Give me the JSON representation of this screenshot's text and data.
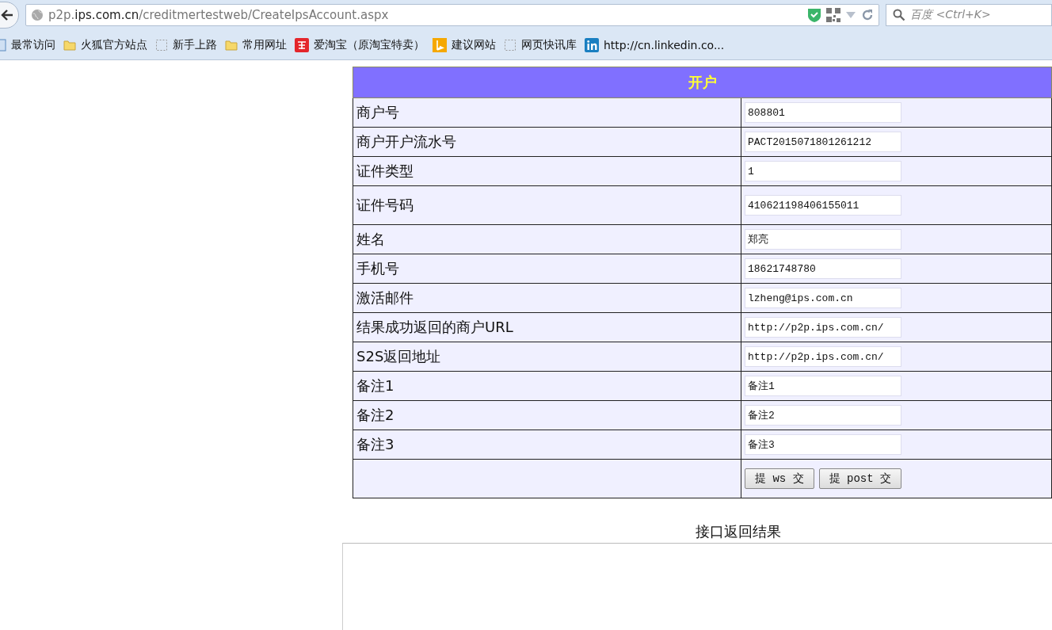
{
  "browser": {
    "url": {
      "host_prefix": "p2p.",
      "host": "ips.com.cn",
      "path": "/creditmertestweb/CreateIpsAccount.aspx"
    },
    "search": {
      "placeholder": "百度 <Ctrl+K>"
    },
    "bookmarks": [
      {
        "kind": "page",
        "label": "最常访问"
      },
      {
        "kind": "folder",
        "label": "火狐官方站点"
      },
      {
        "kind": "dashed",
        "label": "新手上路"
      },
      {
        "kind": "folder",
        "label": "常用网址"
      },
      {
        "kind": "taobao",
        "label": "爱淘宝（原淘宝特卖）"
      },
      {
        "kind": "bing",
        "label": "建议网站"
      },
      {
        "kind": "dashed",
        "label": "网页快讯库"
      },
      {
        "kind": "linkedin",
        "label": "http://cn.linkedin.co..."
      }
    ]
  },
  "form": {
    "title": "开户",
    "rows": [
      {
        "label": "商户号",
        "value": "808801"
      },
      {
        "label": "商户开户流水号",
        "value": "PACT2015071801261212"
      },
      {
        "label": "证件类型",
        "value": "1"
      },
      {
        "label": "证件号码",
        "value": "410621198406155011"
      },
      {
        "label": "姓名",
        "value": "郑亮"
      },
      {
        "label": "手机号",
        "value": "18621748780"
      },
      {
        "label": "激活邮件",
        "value": "lzheng@ips.com.cn"
      },
      {
        "label": "结果成功返回的商户URL",
        "value": "http://p2p.ips.com.cn/"
      },
      {
        "label": "S2S返回地址",
        "value": "http://p2p.ips.com.cn/"
      },
      {
        "label": "备注1",
        "value": "备注1"
      },
      {
        "label": "备注2",
        "value": "备注2"
      },
      {
        "label": "备注3",
        "value": "备注3"
      }
    ],
    "buttons": [
      "提 ws 交",
      "提 post 交"
    ]
  },
  "result": {
    "title": "接口返回结果"
  }
}
